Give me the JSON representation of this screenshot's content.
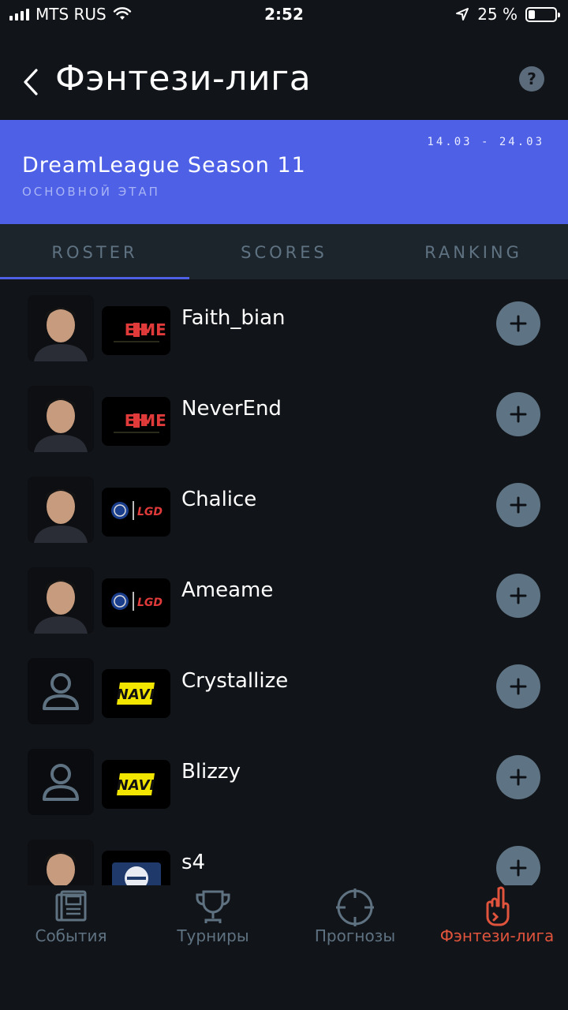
{
  "status_bar": {
    "carrier": "MTS RUS",
    "time": "2:52",
    "battery": "25 %",
    "battery_level": 0.25
  },
  "header": {
    "title": "Фэнтези-лига",
    "help_label": "?"
  },
  "banner": {
    "dates": "14.03 - 24.03",
    "tournament": "DreamLeague Season 11",
    "stage": "ОСНОВНОЙ ЭТАП"
  },
  "tabs": [
    {
      "label": "ROSTER",
      "active": true
    },
    {
      "label": "SCORES",
      "active": false
    },
    {
      "label": "RANKING",
      "active": false
    }
  ],
  "players": [
    {
      "name": "Faith_bian",
      "team": "EHOME",
      "avatar": "photo"
    },
    {
      "name": "NeverEnd",
      "team": "EHOME",
      "avatar": "photo"
    },
    {
      "name": "Chalice",
      "team": "PSG.LGD",
      "avatar": "photo"
    },
    {
      "name": "Ameame",
      "team": "PSG.LGD",
      "avatar": "photo"
    },
    {
      "name": "Crystallize",
      "team": "NAVI",
      "avatar": "placeholder"
    },
    {
      "name": "Blizzy",
      "team": "NAVI",
      "avatar": "placeholder"
    },
    {
      "name": "s4",
      "team": "EG",
      "avatar": "photo"
    }
  ],
  "nav": [
    {
      "label": "События",
      "icon": "news-icon",
      "active": false
    },
    {
      "label": "Турниры",
      "icon": "trophy-icon",
      "active": false
    },
    {
      "label": "Прогнозы",
      "icon": "crosshair-icon",
      "active": false
    },
    {
      "label": "Фэнтези-лига",
      "icon": "hand-icon",
      "active": true
    }
  ],
  "colors": {
    "background": "#111418",
    "banner": "#4d60e6",
    "tab_bar": "#1c252c",
    "inactive": "#5f7282",
    "active_nav": "#e0533c",
    "add_button": "#5e7383"
  }
}
